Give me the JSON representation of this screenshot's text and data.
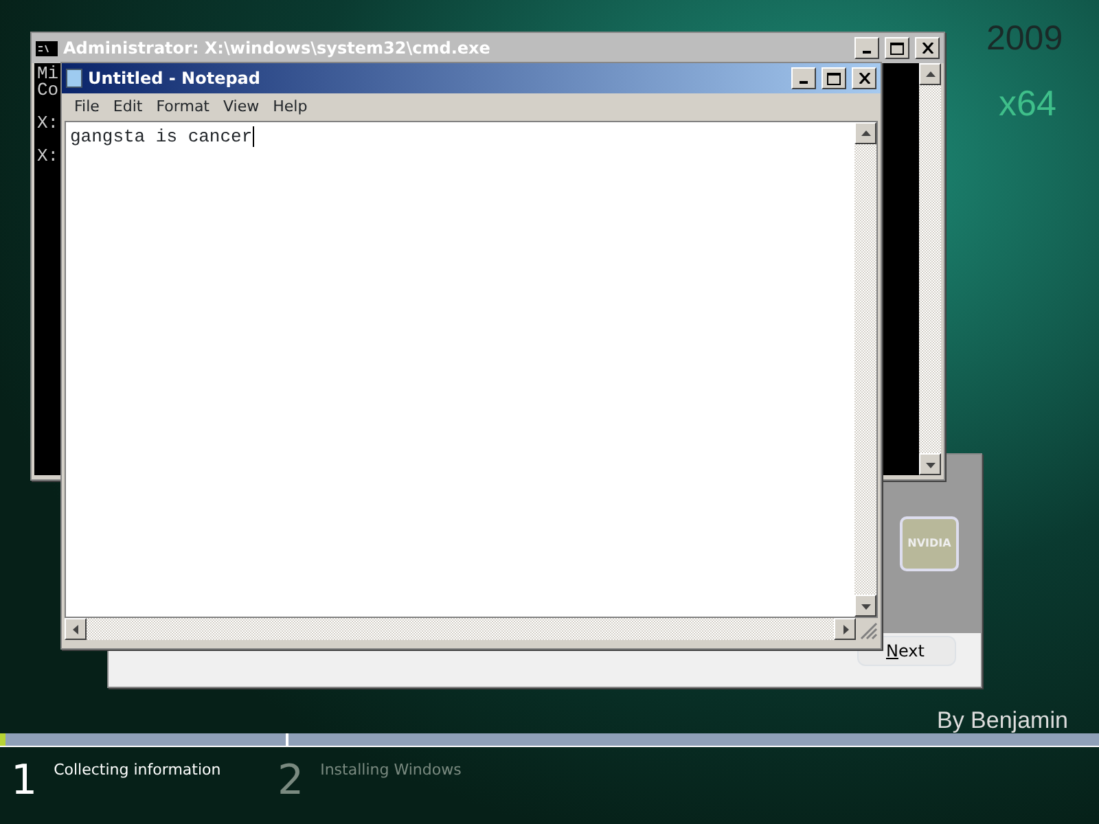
{
  "background": {
    "title": "2009",
    "edition": "x64",
    "credit": "By Benjamin"
  },
  "setup_dialog": {
    "next_button": "Next",
    "logo": "NVIDIA"
  },
  "cmd_window": {
    "title": "Administrator: X:\\windows\\system32\\cmd.exe",
    "lines": [
      "Mi",
      "Co",
      "X:",
      "X:"
    ]
  },
  "notepad": {
    "title": "Untitled - Notepad",
    "menu": [
      "File",
      "Edit",
      "Format",
      "View",
      "Help"
    ],
    "text": "gangsta is cancer"
  },
  "steps": [
    {
      "number": "1",
      "label": "Collecting information",
      "selected": true,
      "level": 0.02
    },
    {
      "number": "2",
      "label": "Installing Windows",
      "selected": false
    }
  ]
}
